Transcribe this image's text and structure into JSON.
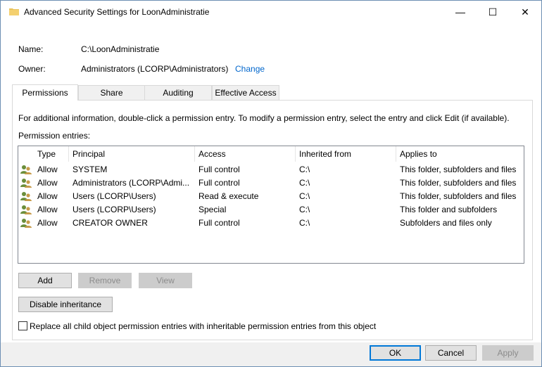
{
  "window": {
    "title": "Advanced Security Settings for LoonAdministratie"
  },
  "titlebar_buttons": {
    "minimize": "—",
    "maximize": "☐",
    "close": "✕"
  },
  "info": {
    "name_label": "Name:",
    "name_value": "C:\\LoonAdministratie",
    "owner_label": "Owner:",
    "owner_value": "Administrators (LCORP\\Administrators)",
    "change_link": "Change"
  },
  "tabs": [
    {
      "label": "Permissions"
    },
    {
      "label": "Share"
    },
    {
      "label": "Auditing"
    },
    {
      "label": "Effective Access"
    }
  ],
  "permissions": {
    "info_text": "For additional information, double-click a permission entry. To modify a permission entry, select the entry and click Edit (if available).",
    "entries_label": "Permission entries:",
    "columns": [
      "Type",
      "Principal",
      "Access",
      "Inherited from",
      "Applies to"
    ],
    "rows": [
      {
        "type": "Allow",
        "principal": "SYSTEM",
        "access": "Full control",
        "inherited": "C:\\",
        "applies": "This folder, subfolders and files"
      },
      {
        "type": "Allow",
        "principal": "Administrators (LCORP\\Admi...",
        "access": "Full control",
        "inherited": "C:\\",
        "applies": "This folder, subfolders and files"
      },
      {
        "type": "Allow",
        "principal": "Users (LCORP\\Users)",
        "access": "Read & execute",
        "inherited": "C:\\",
        "applies": "This folder, subfolders and files"
      },
      {
        "type": "Allow",
        "principal": "Users (LCORP\\Users)",
        "access": "Special",
        "inherited": "C:\\",
        "applies": "This folder and subfolders"
      },
      {
        "type": "Allow",
        "principal": "CREATOR OWNER",
        "access": "Full control",
        "inherited": "C:\\",
        "applies": "Subfolders and files only"
      }
    ],
    "buttons": {
      "add": "Add",
      "remove": "Remove",
      "view": "View",
      "disable_inheritance": "Disable inheritance"
    },
    "replace_checkbox_label": "Replace all child object permission entries with inheritable permission entries from this object",
    "replace_checked": false
  },
  "footer": {
    "ok": "OK",
    "cancel": "Cancel",
    "apply": "Apply"
  },
  "colors": {
    "accent": "#0078d7",
    "link": "#0066cc",
    "disabled_text": "#8c8c8c"
  }
}
